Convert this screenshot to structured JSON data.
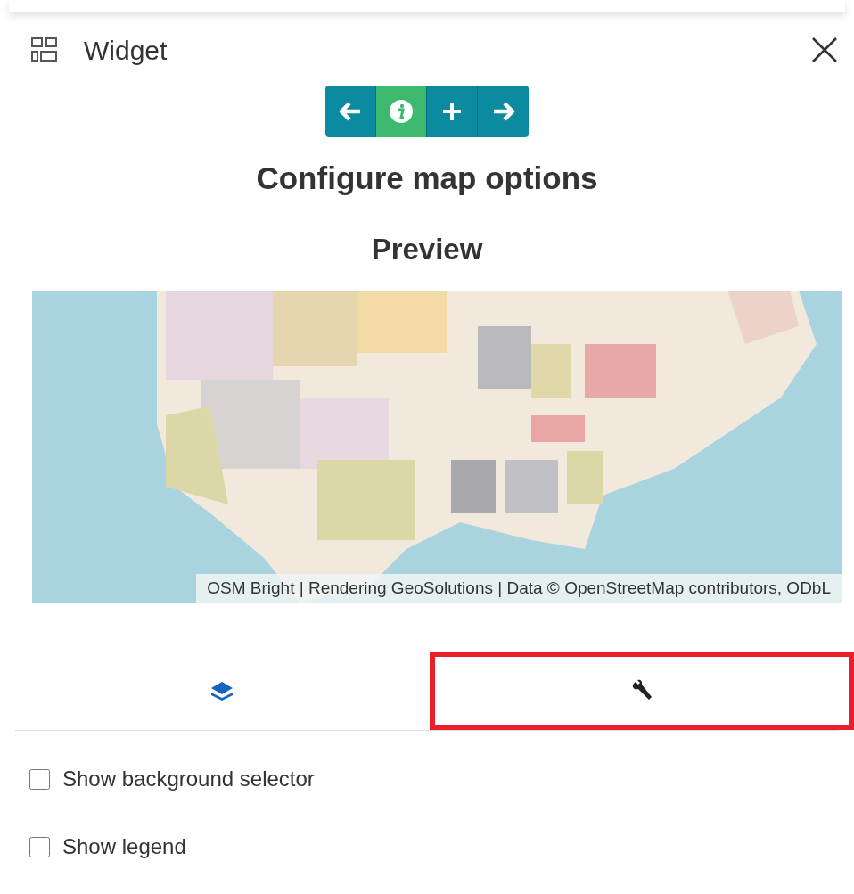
{
  "header": {
    "title": "Widget"
  },
  "steps": [
    {
      "kind": "back",
      "selected": false
    },
    {
      "kind": "info",
      "selected": true
    },
    {
      "kind": "add",
      "selected": false
    },
    {
      "kind": "forward",
      "selected": false
    }
  ],
  "heading": "Configure map options",
  "preview": {
    "title": "Preview",
    "map": {
      "kind": "picture",
      "attribution": "OSM Bright | Rendering GeoSolutions | Data © OpenStreetMap contributors, ODbL"
    }
  },
  "tabs": [
    {
      "kind": "layers",
      "selected": true,
      "highlighted": false
    },
    {
      "kind": "settings",
      "selected": false,
      "highlighted": true
    }
  ],
  "options": [
    {
      "label": "Show background selector",
      "checked": false
    },
    {
      "label": "Show legend",
      "checked": false
    }
  ]
}
